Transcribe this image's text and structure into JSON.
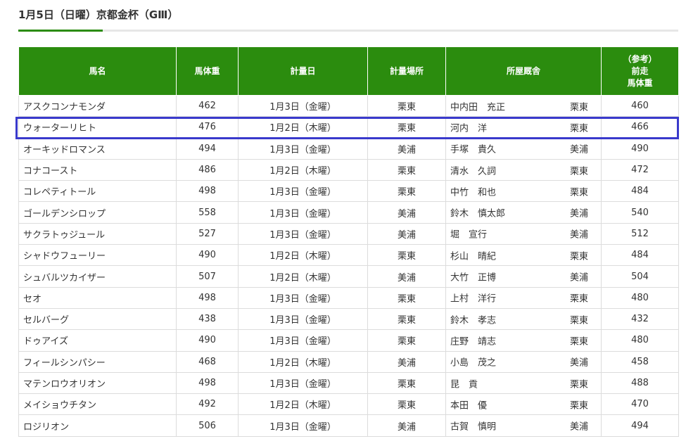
{
  "page_heading": "1月5日（日曜）京都金杯（GⅢ）",
  "table": {
    "headers": {
      "name": "馬名",
      "weight": "馬体重",
      "date": "計量日",
      "place": "計量場所",
      "stable": "所屋厩舎",
      "prev": [
        "（参考）",
        "前走",
        "馬体重"
      ]
    },
    "rows": [
      {
        "name": "アスクコンナモンダ",
        "weight": "462",
        "date": "1月3日（金曜）",
        "place": "栗東",
        "trainer": "中内田　充正",
        "loc": "栗東",
        "prev": "460"
      },
      {
        "name": "ウォーターリヒト",
        "weight": "476",
        "date": "1月2日（木曜）",
        "place": "栗東",
        "trainer": "河内　洋",
        "loc": "栗東",
        "prev": "466"
      },
      {
        "name": "オーキッドロマンス",
        "weight": "494",
        "date": "1月3日（金曜）",
        "place": "美浦",
        "trainer": "手塚　貴久",
        "loc": "美浦",
        "prev": "490"
      },
      {
        "name": "コナコースト",
        "weight": "486",
        "date": "1月2日（木曜）",
        "place": "栗東",
        "trainer": "清水　久詞",
        "loc": "栗東",
        "prev": "472"
      },
      {
        "name": "コレペティトール",
        "weight": "498",
        "date": "1月3日（金曜）",
        "place": "栗東",
        "trainer": "中竹　和也",
        "loc": "栗東",
        "prev": "484"
      },
      {
        "name": "ゴールデンシロップ",
        "weight": "558",
        "date": "1月3日（金曜）",
        "place": "美浦",
        "trainer": "鈴木　慎太郎",
        "loc": "美浦",
        "prev": "540"
      },
      {
        "name": "サクラトゥジュール",
        "weight": "527",
        "date": "1月3日（金曜）",
        "place": "美浦",
        "trainer": "堀　宣行",
        "loc": "美浦",
        "prev": "512"
      },
      {
        "name": "シャドウフューリー",
        "weight": "490",
        "date": "1月2日（木曜）",
        "place": "栗東",
        "trainer": "杉山　晴紀",
        "loc": "栗東",
        "prev": "484"
      },
      {
        "name": "シュバルツカイザー",
        "weight": "507",
        "date": "1月2日（木曜）",
        "place": "美浦",
        "trainer": "大竹　正博",
        "loc": "美浦",
        "prev": "504"
      },
      {
        "name": "セオ",
        "weight": "498",
        "date": "1月3日（金曜）",
        "place": "栗東",
        "trainer": "上村　洋行",
        "loc": "栗東",
        "prev": "480"
      },
      {
        "name": "セルバーグ",
        "weight": "438",
        "date": "1月3日（金曜）",
        "place": "栗東",
        "trainer": "鈴木　孝志",
        "loc": "栗東",
        "prev": "432"
      },
      {
        "name": "ドゥアイズ",
        "weight": "490",
        "date": "1月3日（金曜）",
        "place": "栗東",
        "trainer": "庄野　靖志",
        "loc": "栗東",
        "prev": "480"
      },
      {
        "name": "フィールシンパシー",
        "weight": "468",
        "date": "1月2日（木曜）",
        "place": "美浦",
        "trainer": "小島　茂之",
        "loc": "美浦",
        "prev": "458"
      },
      {
        "name": "マテンロウオリオン",
        "weight": "498",
        "date": "1月3日（金曜）",
        "place": "栗東",
        "trainer": "昆　貢",
        "loc": "栗東",
        "prev": "488"
      },
      {
        "name": "メイショウチタン",
        "weight": "492",
        "date": "1月2日（木曜）",
        "place": "栗東",
        "trainer": "本田　優",
        "loc": "栗東",
        "prev": "470"
      },
      {
        "name": "ロジリオン",
        "weight": "506",
        "date": "1月3日（金曜）",
        "place": "美浦",
        "trainer": "古賀　慎明",
        "loc": "美浦",
        "prev": "494"
      }
    ],
    "highlighted_row": "ウォーターリヒト"
  },
  "colors": {
    "header_green": "#2b8c0e",
    "highlight_border": "#3a3acc",
    "text": "#333333"
  }
}
